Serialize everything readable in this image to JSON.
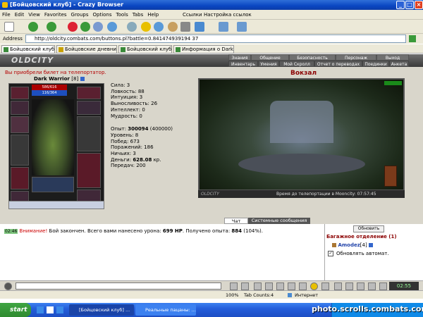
{
  "window": {
    "title": "[Бойцовский клуб] - Crazy Browser"
  },
  "menu": {
    "items": [
      "File",
      "Edit",
      "View",
      "Favorites",
      "Groups",
      "Options",
      "Tools",
      "Tabs",
      "Help"
    ],
    "links_label": "Ссылки",
    "links_settings": "Настройка ссылок"
  },
  "address": {
    "label": "Address",
    "url": "http://oldcity.combats.com/buttons.pl?battle=0.841474939194 37"
  },
  "tabs": [
    "Бойцовский клуб",
    "Бойцовские дневни...",
    "Бойцовский клуб",
    "Информация о Dark..."
  ],
  "game": {
    "logo": "OLDCITY",
    "nav_top": [
      "Знания",
      "Общение",
      "Безопасность",
      "Персонаж",
      "Выход"
    ],
    "nav_bottom": [
      "Инвентарь",
      "Умения",
      "Мой Скролл",
      "Отчет о переводах",
      "Поединки",
      "Анкета"
    ]
  },
  "character": {
    "notice": "Вы приобрели билет на телепортатор.",
    "name": "Dark Warrior",
    "level": "[8]",
    "hp": "586/616",
    "mana": "116/364",
    "stats": [
      {
        "label": "Сила:",
        "value": "3"
      },
      {
        "label": "Ловкость:",
        "value": "88"
      },
      {
        "label": "Интуиция:",
        "value": "3"
      },
      {
        "label": "Выносливость:",
        "value": "26"
      },
      {
        "label": "Интеллект:",
        "value": "0"
      },
      {
        "label": "Мудрость:",
        "value": "0"
      }
    ],
    "experience": {
      "label": "Опыт:",
      "value": "300094",
      "next": "(400000)"
    },
    "info": [
      {
        "label": "Уровень:",
        "value": "8"
      },
      {
        "label": "Побед:",
        "value": "673"
      },
      {
        "label": "Поражений:",
        "value": "186"
      },
      {
        "label": "Ничьих:",
        "value": "3"
      }
    ],
    "money": {
      "label": "Деньги:",
      "value": "628.08",
      "unit": "кр."
    },
    "transfers": {
      "label": "Передач:",
      "value": "200"
    }
  },
  "location": {
    "name": "Вокзал",
    "footer_logo": "OLDCITY",
    "timer": "Время до телепортации в Mooncity: 07:57:45"
  },
  "chat": {
    "tabs": [
      "Чат",
      "Системные сообщения"
    ],
    "time": "02:46",
    "warning": "Внимание!",
    "message_pre": "Бой закончен. Всего вами нанесено урона:",
    "damage": "699 HP",
    "message_mid": ". Получено опыта:",
    "exp": "884",
    "percent": "(104%)."
  },
  "side": {
    "refresh": "Обновить",
    "bag": "Багажное отделение (1)",
    "user": "Amodez",
    "user_level": "[4]",
    "auto": "Обновлять автомат."
  },
  "clock": "02:55",
  "status": {
    "zoom": "100%",
    "tab_count": "Tab Counts:4",
    "zone": "Интернет"
  },
  "taskbar": {
    "start": "start",
    "items": [
      "[Бойцовский клуб] ...",
      "Реальные пацаны: ..."
    ]
  },
  "watermark": "photo.scrolls.combats.com"
}
